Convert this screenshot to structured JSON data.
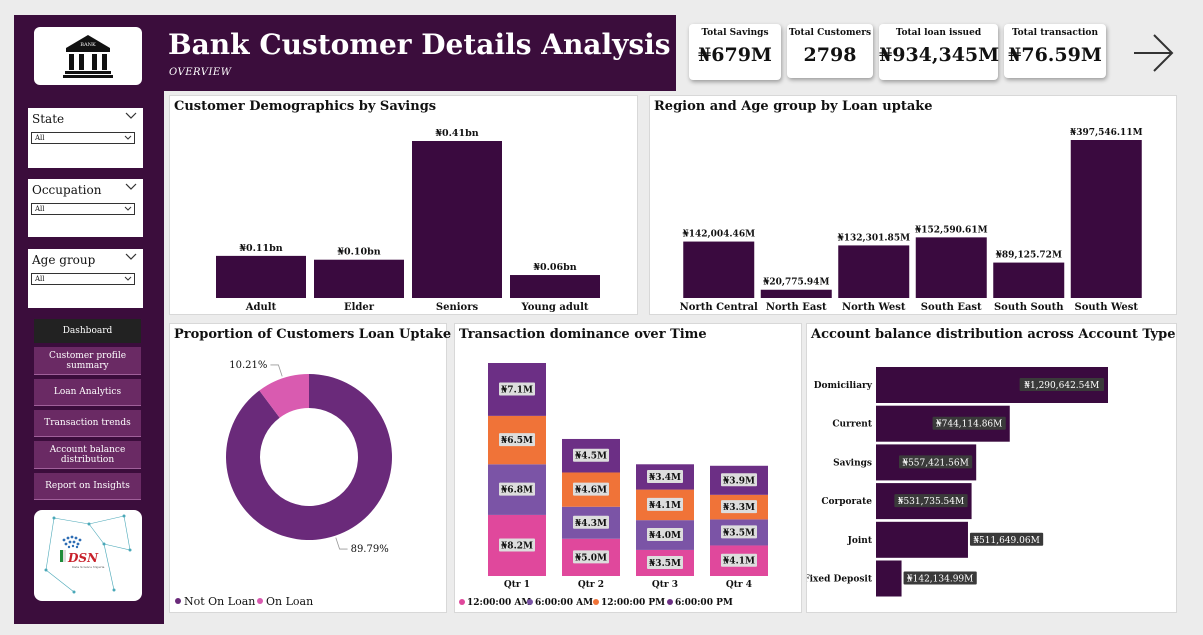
{
  "header": {
    "title": "Bank Customer Details Analysis",
    "subtitle": "OVERVIEW",
    "bank_icon": "bank-building-icon",
    "bank_sign": "BANK"
  },
  "kpis": [
    {
      "label": "Total Savings",
      "value": "₦679M"
    },
    {
      "label": "Total Customers",
      "value": "2798"
    },
    {
      "label": "Total loan issued",
      "value": "₦934,345M"
    },
    {
      "label": "Total transaction",
      "value": "₦76.59M"
    }
  ],
  "next_icon": "arrow-right-icon",
  "slicers": [
    {
      "title": "State",
      "value": "All"
    },
    {
      "title": "Occupation",
      "value": "All"
    },
    {
      "title": "Age group",
      "value": "All"
    }
  ],
  "nav": [
    {
      "label": "Dashboard",
      "active": true
    },
    {
      "label": "Customer profile summary",
      "active": false
    },
    {
      "label": "Loan Analytics",
      "active": false
    },
    {
      "label": "Transaction trends",
      "active": false
    },
    {
      "label": "Account balance distribution",
      "active": false
    },
    {
      "label": "Report on Insights",
      "active": false
    }
  ],
  "dsn_logo": {
    "text": "DSN",
    "tagline": "Data Science Nigeria"
  },
  "colors": {
    "dark_purple": "#3b0d3c",
    "bar": "#3a0a3f",
    "donut_main": "#6a2a7a",
    "donut_pink": "#d95bb0",
    "q_midnight": "#e0489c",
    "q_6am": "#7b54a6",
    "q_noon": "#f07338",
    "q_6pm": "#6c2f85"
  },
  "charts": {
    "demographics": {
      "title": "Customer Demographics by Savings",
      "chart_data": {
        "type": "bar",
        "categories": [
          "Adult",
          "Elder",
          "Seniors",
          "Young adult"
        ],
        "values": [
          0.11,
          0.1,
          0.41,
          0.06
        ],
        "labels": [
          "₦0.11bn",
          "₦0.10bn",
          "₦0.41bn",
          "₦0.06bn"
        ],
        "ylim": [
          0,
          0.41
        ]
      }
    },
    "region": {
      "title": "Region and Age group by Loan uptake",
      "chart_data": {
        "type": "bar",
        "categories": [
          "North Central",
          "North East",
          "North West",
          "South East",
          "South South",
          "South West"
        ],
        "values": [
          142004.46,
          20775.94,
          132301.85,
          152590.61,
          89125.72,
          397546.11
        ],
        "labels": [
          "₦142,004.46M",
          "₦20,775.94M",
          "₦132,301.85M",
          "₦152,590.61M",
          "₦89,125.72M",
          "₦397,546.11M"
        ],
        "ylim": [
          0,
          397546.11
        ]
      }
    },
    "loan_uptake": {
      "title": "Proportion of Customers Loan Uptake",
      "chart_data": {
        "type": "pie",
        "series": [
          {
            "name": "Not On Loan",
            "value": 89.79,
            "label": "89.79%"
          },
          {
            "name": "On Loan",
            "value": 10.21,
            "label": "10.21%"
          }
        ],
        "legend": "bottom-left"
      }
    },
    "transactions": {
      "title": "Transaction dominance over Time",
      "chart_data": {
        "type": "bar",
        "stacked": true,
        "categories": [
          "Qtr 1",
          "Qtr 2",
          "Qtr 3",
          "Qtr 4"
        ],
        "series": [
          {
            "name": "12:00:00 AM",
            "values": [
              8.2,
              5.0,
              3.5,
              4.1
            ],
            "labels": [
              "₦8.2M",
              "₦5.0M",
              "₦3.5M",
              "₦4.1M"
            ]
          },
          {
            "name": "6:00:00 AM",
            "values": [
              6.8,
              4.3,
              4.0,
              3.5
            ],
            "labels": [
              "₦6.8M",
              "₦4.3M",
              "₦4.0M",
              "₦3.5M"
            ]
          },
          {
            "name": "12:00:00 PM",
            "values": [
              6.5,
              4.6,
              4.1,
              3.3
            ],
            "labels": [
              "₦6.5M",
              "₦4.6M",
              "₦4.1M",
              "₦3.3M"
            ]
          },
          {
            "name": "6:00:00 PM",
            "values": [
              7.1,
              4.5,
              3.4,
              3.9
            ],
            "labels": [
              "₦7.1M",
              "₦4.5M",
              "₦3.4M",
              "₦3.9M"
            ]
          }
        ],
        "legend": "bottom"
      }
    },
    "account_balance": {
      "title": "Account balance distribution across Account Type",
      "chart_data": {
        "type": "bar",
        "orientation": "horizontal",
        "categories": [
          "Domiciliary",
          "Current",
          "Savings",
          "Corporate",
          "Joint",
          "Fixed Deposit"
        ],
        "values": [
          1290642.54,
          744114.86,
          557421.56,
          531735.54,
          511649.06,
          142134.99
        ],
        "labels": [
          "₦1,290,642.54M",
          "₦744,114.86M",
          "₦557,421.56M",
          "₦531,735.54M",
          "₦511,649.06M",
          "₦142,134.99M"
        ],
        "xlim": [
          0,
          1290642.54
        ]
      }
    }
  }
}
